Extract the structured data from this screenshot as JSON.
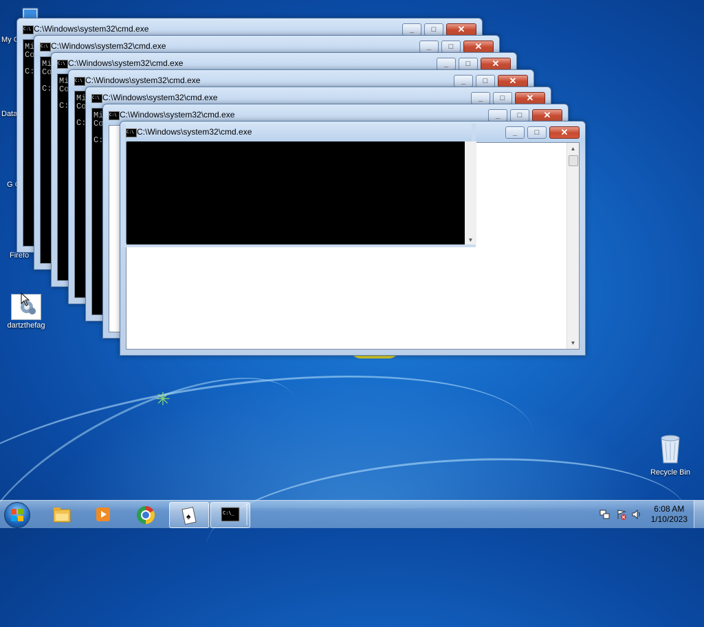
{
  "desktop": {
    "icons": [
      {
        "label": "My C",
        "icon": "computer-icon"
      },
      {
        "label": "Data",
        "icon": "shortcut-icon"
      },
      {
        "label": "G C",
        "icon": "chrome-icon"
      },
      {
        "label": "Firefo",
        "icon": "firefox-icon"
      },
      {
        "label": "dartzthefag",
        "icon": "settings-file-icon"
      },
      {
        "label": "Recycle Bin",
        "icon": "recycle-bin-icon"
      }
    ]
  },
  "windows": {
    "title": "C:\\Windows\\system32\\cmd.exe",
    "console_lines": [
      "Mi",
      "Co",
      "",
      "C:"
    ]
  },
  "taskbar": {
    "start_label": "Start",
    "pinned": [
      {
        "name": "explorer",
        "icon": "folder-icon"
      },
      {
        "name": "media-player",
        "icon": "media-player-icon"
      },
      {
        "name": "chrome",
        "icon": "chrome-icon"
      },
      {
        "name": "solitaire",
        "icon": "cards-icon"
      },
      {
        "name": "cmd",
        "icon": "cmd-icon"
      }
    ],
    "clock": {
      "time": "6:08 AM",
      "date": "1/10/2023"
    }
  },
  "colors": {
    "desktop_blue": "#1466c4",
    "close_red": "#c74a31",
    "console_bg": "#000000"
  }
}
